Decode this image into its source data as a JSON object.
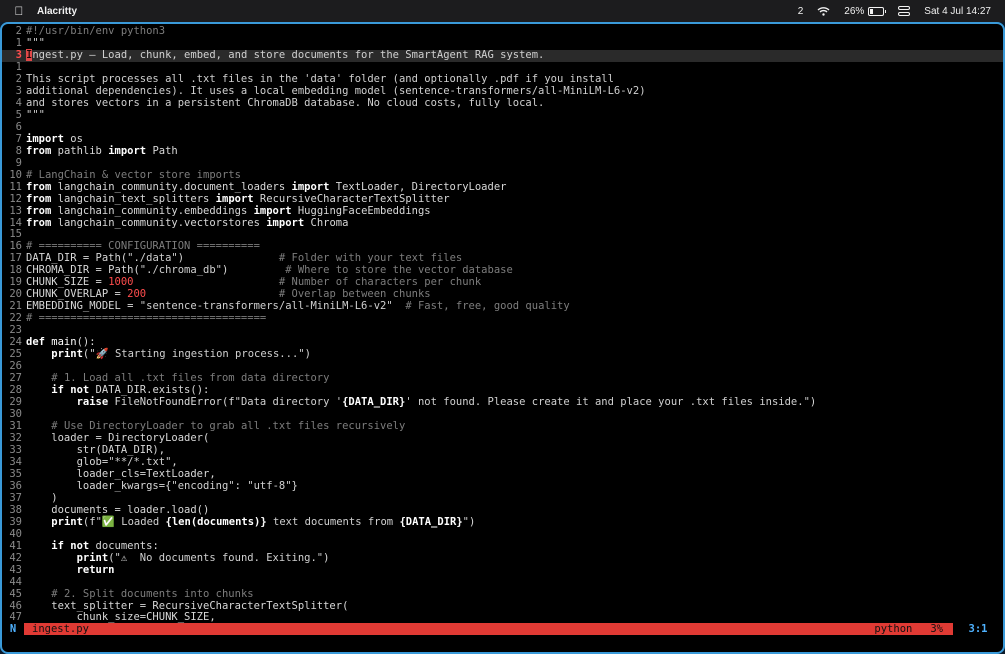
{
  "menubar": {
    "app_name": "Alacritty",
    "notification_count": "2",
    "battery_percent": "26%",
    "battery_level": 0.26,
    "datetime": "Sat 4 Jul  14:27"
  },
  "editor": {
    "lines": [
      {
        "num": "2",
        "segs": [
          [
            "cm",
            "#!/usr/bin/env python3"
          ]
        ]
      },
      {
        "num": "1",
        "segs": [
          [
            "str",
            "\"\"\""
          ]
        ]
      },
      {
        "num": "3",
        "current": true,
        "segs": [
          [
            "cursor",
            "I"
          ],
          [
            "str",
            "ngest.py — Load, chunk, embed, and store documents for the SmartAgent RAG system."
          ]
        ]
      },
      {
        "num": "1",
        "segs": []
      },
      {
        "num": "2",
        "segs": [
          [
            "str",
            "This script processes all .txt files in the 'data' folder (and optionally .pdf if you install"
          ]
        ]
      },
      {
        "num": "3",
        "segs": [
          [
            "str",
            "additional dependencies). It uses a local embedding model (sentence-transformers/all-MiniLM-L6-v2)"
          ]
        ]
      },
      {
        "num": "4",
        "segs": [
          [
            "str",
            "and stores vectors in a persistent ChromaDB database. No cloud costs, fully local."
          ]
        ]
      },
      {
        "num": "5",
        "segs": [
          [
            "str",
            "\"\"\""
          ]
        ]
      },
      {
        "num": "6",
        "segs": []
      },
      {
        "num": "7",
        "segs": [
          [
            "kw",
            "import"
          ],
          [
            "txt",
            " os"
          ]
        ]
      },
      {
        "num": "8",
        "segs": [
          [
            "kw",
            "from"
          ],
          [
            "txt",
            " pathlib "
          ],
          [
            "kw",
            "import"
          ],
          [
            "txt",
            " Path"
          ]
        ]
      },
      {
        "num": "9",
        "segs": []
      },
      {
        "num": "10",
        "segs": [
          [
            "cm",
            "# LangChain & vector store imports"
          ]
        ]
      },
      {
        "num": "11",
        "segs": [
          [
            "kw",
            "from"
          ],
          [
            "txt",
            " langchain_community.document_loaders "
          ],
          [
            "kw",
            "import"
          ],
          [
            "txt",
            " TextLoader, DirectoryLoader"
          ]
        ]
      },
      {
        "num": "12",
        "segs": [
          [
            "kw",
            "from"
          ],
          [
            "txt",
            " langchain_text_splitters "
          ],
          [
            "kw",
            "import"
          ],
          [
            "txt",
            " RecursiveCharacterTextSplitter"
          ]
        ]
      },
      {
        "num": "13",
        "segs": [
          [
            "kw",
            "from"
          ],
          [
            "txt",
            " langchain_community.embeddings "
          ],
          [
            "kw",
            "import"
          ],
          [
            "txt",
            " HuggingFaceEmbeddings"
          ]
        ]
      },
      {
        "num": "14",
        "segs": [
          [
            "kw",
            "from"
          ],
          [
            "txt",
            " langchain_community.vectorstores "
          ],
          [
            "kw",
            "import"
          ],
          [
            "txt",
            " Chroma"
          ]
        ]
      },
      {
        "num": "15",
        "segs": []
      },
      {
        "num": "16",
        "segs": [
          [
            "cm",
            "# ========== CONFIGURATION =========="
          ]
        ]
      },
      {
        "num": "17",
        "segs": [
          [
            "txt",
            "DATA_DIR = Path("
          ],
          [
            "str",
            "\"./data\""
          ],
          [
            "txt",
            ")               "
          ],
          [
            "cm",
            "# Folder with your text files"
          ]
        ]
      },
      {
        "num": "18",
        "segs": [
          [
            "txt",
            "CHROMA_DIR = Path("
          ],
          [
            "str",
            "\"./chroma_db\""
          ],
          [
            "txt",
            ")         "
          ],
          [
            "cm",
            "# Where to store the vector database"
          ]
        ]
      },
      {
        "num": "19",
        "segs": [
          [
            "txt",
            "CHUNK_SIZE = "
          ],
          [
            "num",
            "1000"
          ],
          [
            "txt",
            "                       "
          ],
          [
            "cm",
            "# Number of characters per chunk"
          ]
        ]
      },
      {
        "num": "20",
        "segs": [
          [
            "txt",
            "CHUNK_OVERLAP = "
          ],
          [
            "num",
            "200"
          ],
          [
            "txt",
            "                     "
          ],
          [
            "cm",
            "# Overlap between chunks"
          ]
        ]
      },
      {
        "num": "21",
        "segs": [
          [
            "txt",
            "EMBEDDING_MODEL = "
          ],
          [
            "str",
            "\"sentence-transformers/all-MiniLM-L6-v2\""
          ],
          [
            "txt",
            "  "
          ],
          [
            "cm",
            "# Fast, free, good quality"
          ]
        ]
      },
      {
        "num": "22",
        "segs": [
          [
            "cm",
            "# ===================================="
          ]
        ]
      },
      {
        "num": "23",
        "segs": []
      },
      {
        "num": "24",
        "segs": [
          [
            "kw",
            "def"
          ],
          [
            "fn",
            " main"
          ],
          [
            "txt",
            "():"
          ]
        ]
      },
      {
        "num": "25",
        "segs": [
          [
            "txt",
            "    "
          ],
          [
            "kw",
            "print"
          ],
          [
            "txt",
            "("
          ],
          [
            "str",
            "\"🚀 Starting ingestion process...\""
          ],
          [
            "txt",
            ")"
          ]
        ]
      },
      {
        "num": "26",
        "segs": []
      },
      {
        "num": "27",
        "segs": [
          [
            "txt",
            "    "
          ],
          [
            "cm",
            "# 1. Load all .txt files from data directory"
          ]
        ]
      },
      {
        "num": "28",
        "segs": [
          [
            "txt",
            "    "
          ],
          [
            "kw",
            "if not"
          ],
          [
            "txt",
            " DATA_DIR.exists():"
          ]
        ]
      },
      {
        "num": "29",
        "segs": [
          [
            "txt",
            "        "
          ],
          [
            "kw",
            "raise"
          ],
          [
            "txt",
            " FileNotFoundError(f"
          ],
          [
            "str",
            "\"Data directory '"
          ],
          [
            "kw",
            "{DATA_DIR}"
          ],
          [
            "str",
            "' not found. Please create it and place your .txt files inside.\""
          ],
          [
            "txt",
            ")"
          ]
        ]
      },
      {
        "num": "30",
        "segs": []
      },
      {
        "num": "31",
        "segs": [
          [
            "txt",
            "    "
          ],
          [
            "cm",
            "# Use DirectoryLoader to grab all .txt files recursively"
          ]
        ]
      },
      {
        "num": "32",
        "segs": [
          [
            "txt",
            "    loader = DirectoryLoader("
          ]
        ]
      },
      {
        "num": "33",
        "segs": [
          [
            "txt",
            "        str(DATA_DIR),"
          ]
        ]
      },
      {
        "num": "34",
        "segs": [
          [
            "txt",
            "        glob="
          ],
          [
            "str",
            "\"**/*.txt\""
          ],
          [
            "txt",
            ","
          ]
        ]
      },
      {
        "num": "35",
        "segs": [
          [
            "txt",
            "        loader_cls=TextLoader,"
          ]
        ]
      },
      {
        "num": "36",
        "segs": [
          [
            "txt",
            "        loader_kwargs={"
          ],
          [
            "str",
            "\"encoding\""
          ],
          [
            "txt",
            ": "
          ],
          [
            "str",
            "\"utf-8\""
          ],
          [
            "txt",
            "}"
          ]
        ]
      },
      {
        "num": "37",
        "segs": [
          [
            "txt",
            "    )"
          ]
        ]
      },
      {
        "num": "38",
        "segs": [
          [
            "txt",
            "    documents = loader.load()"
          ]
        ]
      },
      {
        "num": "39",
        "segs": [
          [
            "txt",
            "    "
          ],
          [
            "kw",
            "print"
          ],
          [
            "txt",
            "(f"
          ],
          [
            "str",
            "\"✅ Loaded "
          ],
          [
            "kw",
            "{len(documents)}"
          ],
          [
            "str",
            " text documents from "
          ],
          [
            "kw",
            "{DATA_DIR}"
          ],
          [
            "str",
            "\""
          ],
          [
            "txt",
            ")"
          ]
        ]
      },
      {
        "num": "40",
        "segs": []
      },
      {
        "num": "41",
        "segs": [
          [
            "txt",
            "    "
          ],
          [
            "kw",
            "if not"
          ],
          [
            "txt",
            " documents:"
          ]
        ]
      },
      {
        "num": "42",
        "segs": [
          [
            "txt",
            "        "
          ],
          [
            "kw",
            "print"
          ],
          [
            "txt",
            "("
          ],
          [
            "str",
            "\"⚠  No documents found. Exiting.\""
          ],
          [
            "txt",
            ")"
          ]
        ]
      },
      {
        "num": "43",
        "segs": [
          [
            "txt",
            "        "
          ],
          [
            "kw",
            "return"
          ]
        ]
      },
      {
        "num": "44",
        "segs": []
      },
      {
        "num": "45",
        "segs": [
          [
            "txt",
            "    "
          ],
          [
            "cm",
            "# 2. Split documents into chunks"
          ]
        ]
      },
      {
        "num": "46",
        "segs": [
          [
            "txt",
            "    text_splitter = RecursiveCharacterTextSplitter("
          ]
        ]
      },
      {
        "num": "47",
        "segs": [
          [
            "txt",
            "        chunk_size=CHUNK_SIZE,"
          ]
        ]
      }
    ]
  },
  "statusbar": {
    "mode": "N",
    "filename": "ingest.py",
    "filetype": "python",
    "percent": "3%",
    "position": "3:1"
  }
}
